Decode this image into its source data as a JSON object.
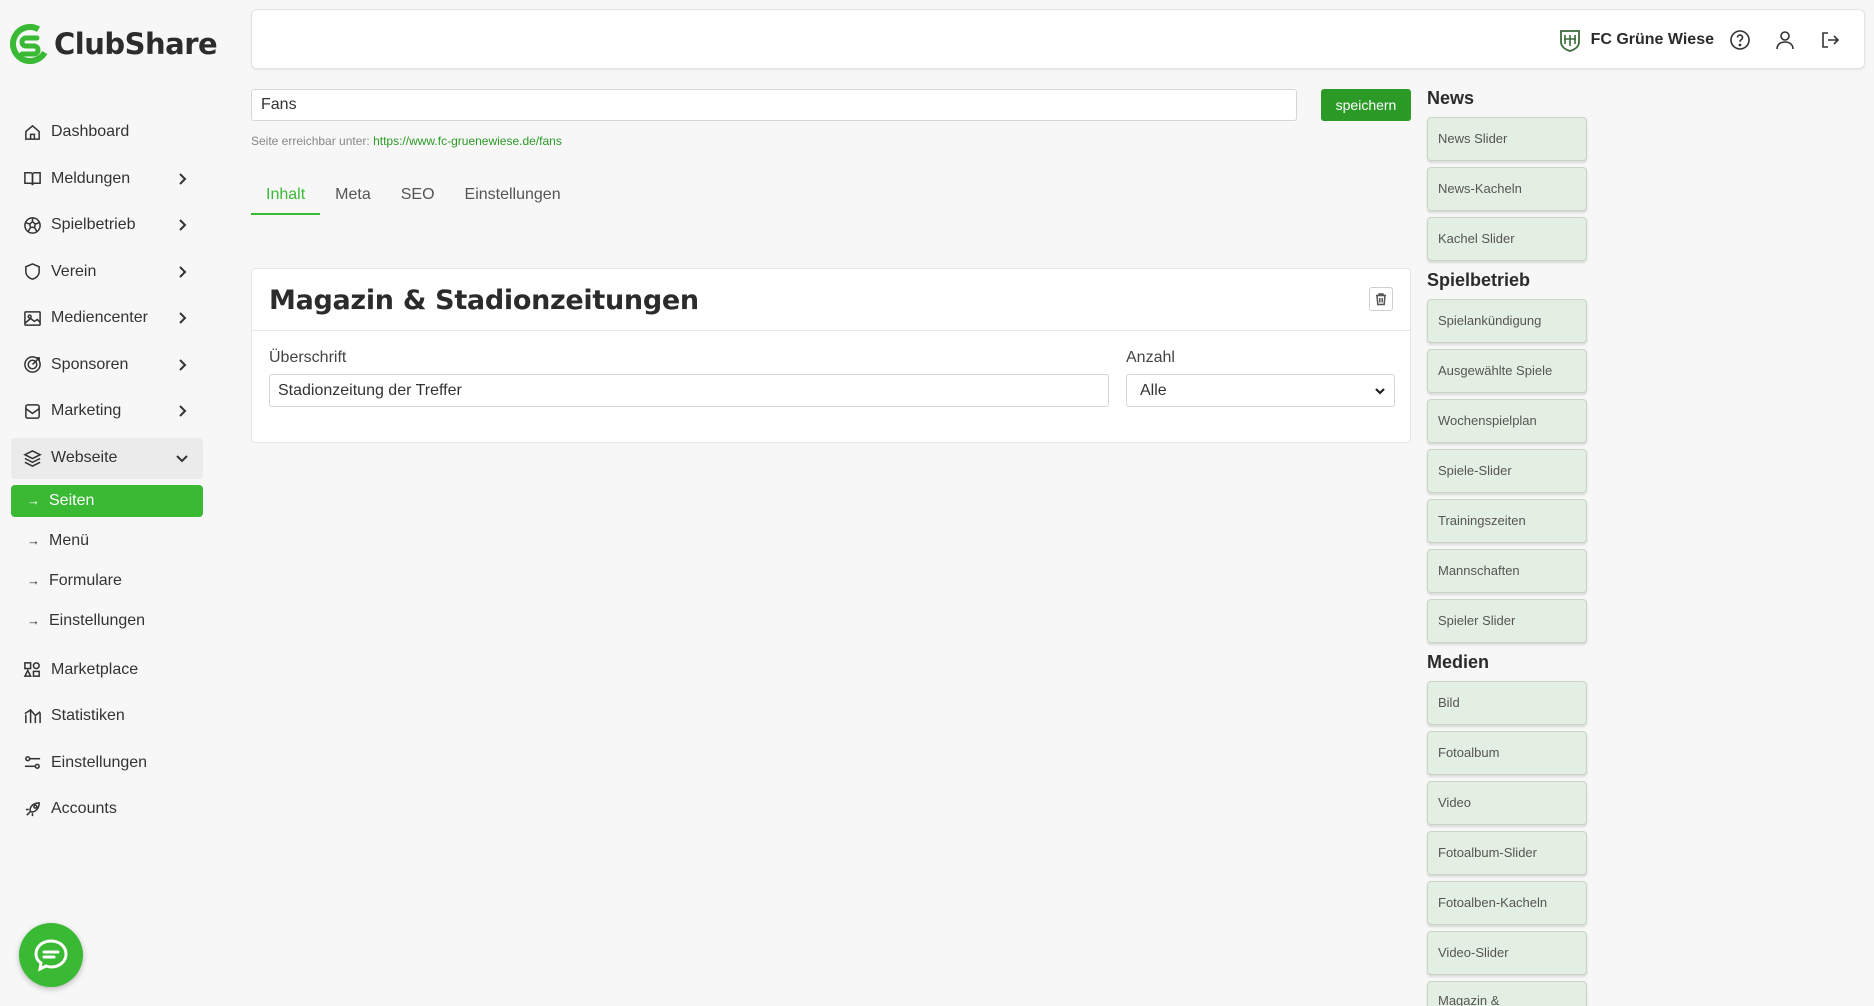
{
  "app": {
    "name": "ClubShare"
  },
  "sidebar": {
    "items": [
      {
        "label": "Dashboard",
        "icon": "home-icon",
        "has_children": false
      },
      {
        "label": "Meldungen",
        "icon": "book-icon",
        "has_children": true
      },
      {
        "label": "Spielbetrieb",
        "icon": "soccer-ball-icon",
        "has_children": true
      },
      {
        "label": "Verein",
        "icon": "shield-icon",
        "has_children": true
      },
      {
        "label": "Mediencenter",
        "icon": "image-icon",
        "has_children": true
      },
      {
        "label": "Sponsoren",
        "icon": "target-icon",
        "has_children": true
      },
      {
        "label": "Marketing",
        "icon": "mail-icon",
        "has_children": true
      },
      {
        "label": "Webseite",
        "icon": "layers-icon",
        "has_children": true,
        "expanded": true
      }
    ],
    "sub_items": [
      {
        "label": "Seiten",
        "active": true
      },
      {
        "label": "Menü",
        "active": false
      },
      {
        "label": "Formulare",
        "active": false
      },
      {
        "label": "Einstellungen",
        "active": false
      }
    ],
    "bottom_items": [
      {
        "label": "Marketplace",
        "icon": "shapes-icon"
      },
      {
        "label": "Statistiken",
        "icon": "chart-icon"
      },
      {
        "label": "Einstellungen",
        "icon": "sliders-icon"
      },
      {
        "label": "Accounts",
        "icon": "rocket-icon"
      }
    ]
  },
  "topbar": {
    "club_name": "FC Grüne Wiese"
  },
  "editor": {
    "page_title_value": "Fans",
    "save_label": "speichern",
    "url_prefix": "Seite erreichbar unter:",
    "url": "https://www.fc-gruenewiese.de/fans",
    "tabs": [
      "Inhalt",
      "Meta",
      "SEO",
      "Einstellungen"
    ],
    "active_tab": "Inhalt"
  },
  "block": {
    "title": "Magazin & Stadionzeitungen",
    "heading_label": "Überschrift",
    "heading_value": "Stadionzeitung der Treffer",
    "count_label": "Anzahl",
    "count_value": "Alle"
  },
  "palette": {
    "groups": [
      {
        "heading": "News",
        "items": [
          "News Slider",
          "News-Kacheln",
          "Kachel Slider"
        ]
      },
      {
        "heading": "Spielbetrieb",
        "items": [
          "Spielankündigung",
          "Ausgewählte Spiele",
          "Wochenspielplan",
          "Spiele-Slider",
          "Trainingszeiten",
          "Mannschaften",
          "Spieler Slider"
        ]
      },
      {
        "heading": "Medien",
        "items": [
          "Bild",
          "Fotoalbum",
          "Video",
          "Fotoalbum-Slider",
          "Fotoalben-Kacheln",
          "Video-Slider",
          "Magazin & Stadionzeitungen"
        ]
      }
    ]
  },
  "colors": {
    "accent": "#3ab934",
    "save_button": "#2b9a27",
    "palette_item": "#e4efe3"
  }
}
